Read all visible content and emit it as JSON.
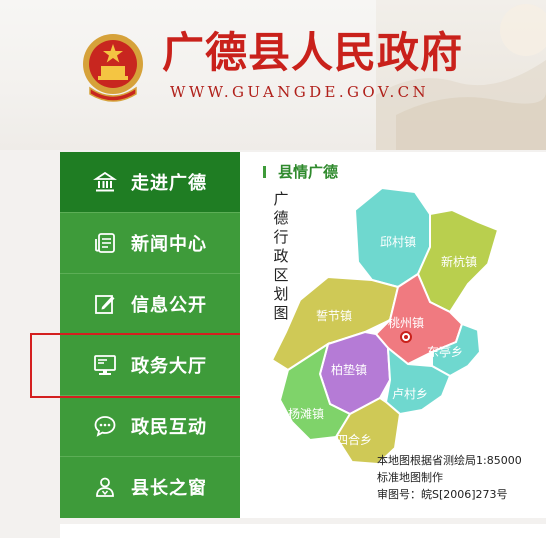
{
  "header": {
    "title": "广德县人民政府",
    "url": "WWW.GUANGDE.GOV.CN"
  },
  "nav": {
    "items": [
      {
        "label": "走进广德",
        "icon": "bank-icon",
        "active": true
      },
      {
        "label": "新闻中心",
        "icon": "news-icon",
        "active": false
      },
      {
        "label": "信息公开",
        "icon": "edit-icon",
        "active": false
      },
      {
        "label": "政务大厅",
        "icon": "monitor-icon",
        "active": false
      },
      {
        "label": "政民互动",
        "icon": "chat-icon",
        "active": false
      },
      {
        "label": "县长之窗",
        "icon": "users-icon",
        "active": false
      }
    ]
  },
  "panel": {
    "title": "县情广德",
    "vertical_title": "广德行政区划图"
  },
  "map": {
    "regions": [
      {
        "name": "邱村镇",
        "color": "#6fd8cf"
      },
      {
        "name": "新杭镇",
        "color": "#b9cf4e"
      },
      {
        "name": "誓节镇",
        "color": "#cfc956"
      },
      {
        "name": "桃州镇",
        "color": "#f07a80"
      },
      {
        "name": "东亭乡",
        "color": "#6fd8cf"
      },
      {
        "name": "柏垫镇",
        "color": "#b57bd6"
      },
      {
        "name": "卢村乡",
        "color": "#6fd8cf"
      },
      {
        "name": "杨滩镇",
        "color": "#7fd36a"
      },
      {
        "name": "四合乡",
        "color": "#cfc956"
      }
    ],
    "notes": [
      "本地图根据省测绘局1:85000",
      "标准地图制作",
      "审图号：皖S[2006]273号"
    ]
  },
  "colors": {
    "brand_red": "#c9211b",
    "nav_green": "#3e9b3a",
    "nav_active": "#1f7d23",
    "highlight_red": "#d41f1f"
  }
}
